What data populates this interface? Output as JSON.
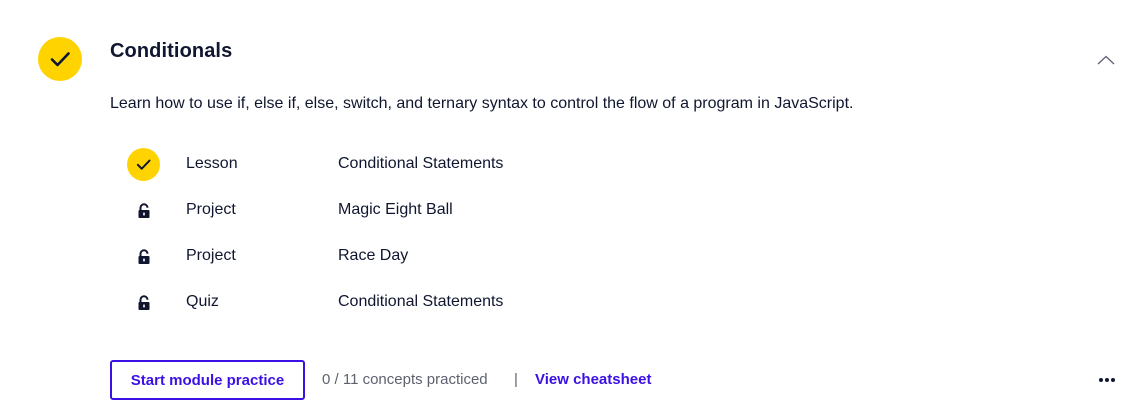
{
  "module": {
    "title": "Conditionals",
    "description": "Learn how to use if, else if, else, switch, and ternary syntax to control the flow of a program in JavaScript.",
    "completed": true
  },
  "items": [
    {
      "kind": "Lesson",
      "name": "Conditional Statements",
      "status": "completed",
      "icon": "check-icon"
    },
    {
      "kind": "Project",
      "name": "Magic Eight Ball",
      "status": "locked",
      "icon": "lock-icon"
    },
    {
      "kind": "Project",
      "name": "Race Day",
      "status": "locked",
      "icon": "lock-icon"
    },
    {
      "kind": "Quiz",
      "name": "Conditional Statements",
      "status": "locked",
      "icon": "lock-icon"
    }
  ],
  "footer": {
    "practice_button": "Start module practice",
    "concepts_text": "0 / 11 concepts practiced",
    "separator": "|",
    "cheatsheet_link": "View cheatsheet"
  },
  "colors": {
    "accent": "#3a10e5",
    "check_bg": "#ffd300",
    "text": "#10162f",
    "muted": "#5e6270"
  },
  "icons": {
    "module_status": "check-icon",
    "collapse": "chevron-up-icon",
    "more": "more-horizontal-icon"
  }
}
